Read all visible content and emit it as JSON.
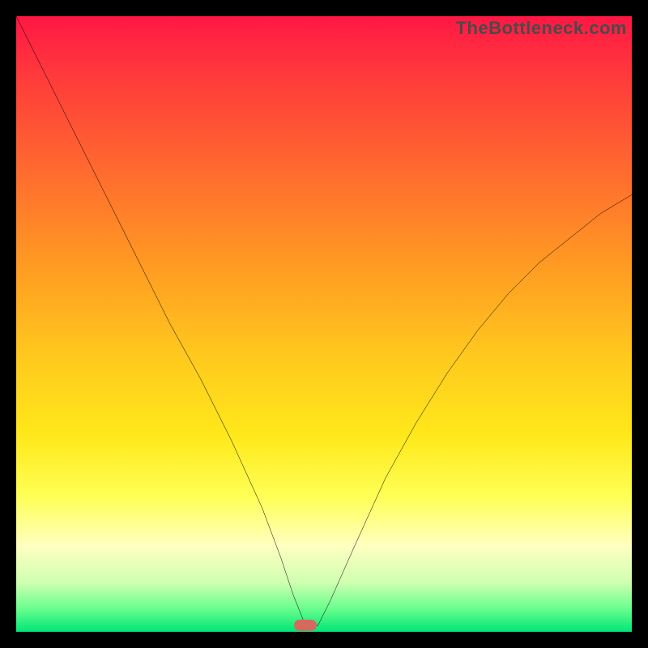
{
  "attribution": "TheBottleneck.com",
  "colors": {
    "frame": "#000000",
    "gradient_top": "#ff1744",
    "gradient_bottom": "#00e676",
    "curve_stroke": "#000000",
    "marker_fill": "#d46a5e"
  },
  "chart_data": {
    "type": "line",
    "title": "",
    "xlabel": "",
    "ylabel": "",
    "xlim": [
      0,
      100
    ],
    "ylim": [
      0,
      100
    ],
    "grid": false,
    "legend": false,
    "annotations": [
      "TheBottleneck.com"
    ],
    "marker": {
      "x": 47,
      "y": 1,
      "shape": "rounded-bar"
    },
    "series": [
      {
        "name": "bottleneck-curve",
        "x": [
          0,
          5,
          10,
          15,
          20,
          25,
          30,
          35,
          40,
          43,
          45,
          47,
          49,
          51,
          55,
          60,
          65,
          70,
          75,
          80,
          85,
          90,
          95,
          100
        ],
        "y": [
          100,
          90,
          80,
          70,
          60,
          50,
          41,
          31,
          20,
          12,
          6,
          1,
          1,
          5,
          14,
          25,
          34,
          42,
          49,
          55,
          60,
          64,
          68,
          71
        ]
      }
    ]
  }
}
